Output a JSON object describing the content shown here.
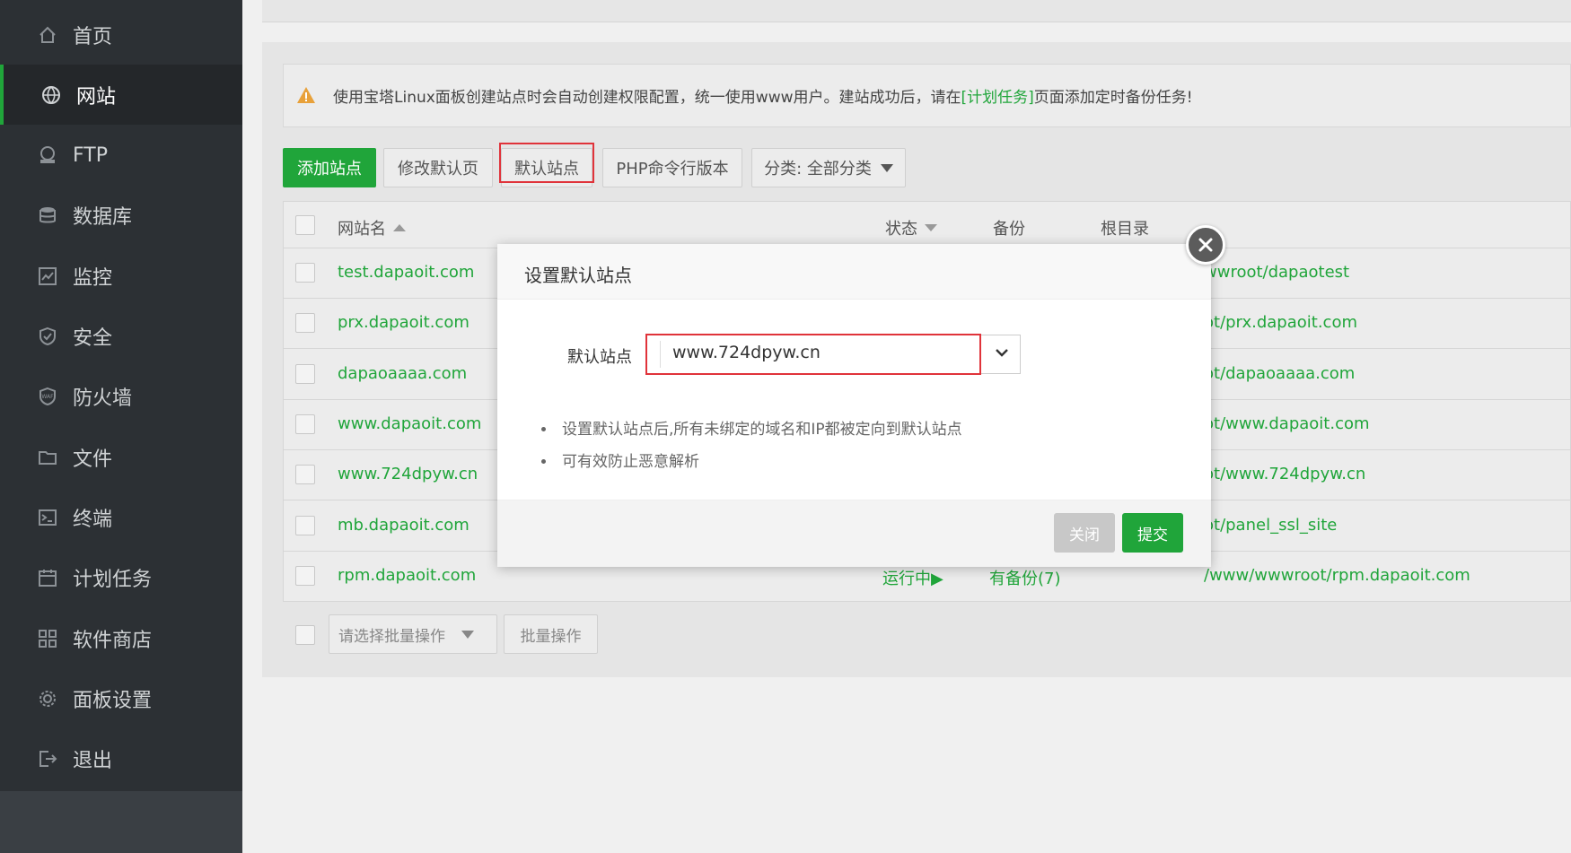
{
  "colors": {
    "accent": "#20a53a",
    "highlight": "#e0333a",
    "sidebar_bg": "#2c3034"
  },
  "sidebar": {
    "items": [
      {
        "label": "首页",
        "icon": "home-icon",
        "active": false
      },
      {
        "label": "网站",
        "icon": "globe-icon",
        "active": true
      },
      {
        "label": "FTP",
        "icon": "ftp-icon",
        "active": false
      },
      {
        "label": "数据库",
        "icon": "database-icon",
        "active": false
      },
      {
        "label": "监控",
        "icon": "monitor-icon",
        "active": false
      },
      {
        "label": "安全",
        "icon": "shield-icon",
        "active": false
      },
      {
        "label": "防火墙",
        "icon": "waf-shield-icon",
        "active": false
      },
      {
        "label": "文件",
        "icon": "folder-icon",
        "active": false
      },
      {
        "label": "终端",
        "icon": "terminal-icon",
        "active": false
      },
      {
        "label": "计划任务",
        "icon": "calendar-icon",
        "active": false
      },
      {
        "label": "软件商店",
        "icon": "grid-icon",
        "active": false
      },
      {
        "label": "面板设置",
        "icon": "gear-icon",
        "active": false
      },
      {
        "label": "退出",
        "icon": "logout-icon",
        "active": false
      }
    ]
  },
  "notice": {
    "prefix": "使用宝塔Linux面板创建站点时会自动创建权限配置，统一使用www用户。建站成功后，请在",
    "link": "[计划任务]",
    "suffix": "页面添加定时备份任务!"
  },
  "toolbar": {
    "add_site": "添加站点",
    "edit_default_page": "修改默认页",
    "default_site": "默认站点",
    "php_cli_version": "PHP命令行版本",
    "category": "分类: 全部分类"
  },
  "table": {
    "headers": {
      "name": "网站名",
      "status": "状态",
      "backup": "备份",
      "root": "根目录"
    },
    "rows": [
      {
        "name": "test.dapaoit.com",
        "root": "wwroot/dapaotest",
        "status": "",
        "backup": ""
      },
      {
        "name": "prx.dapaoit.com",
        "root": "ot/prx.dapaoit.com",
        "status": "",
        "backup": ""
      },
      {
        "name": "dapaoaaaa.com",
        "root": "ot/dapaoaaaa.com",
        "status": "",
        "backup": ""
      },
      {
        "name": "www.dapaoit.com",
        "root": "ot/www.dapaoit.com",
        "status": "",
        "backup": ""
      },
      {
        "name": "www.724dpyw.cn",
        "root": "ot/www.724dpyw.cn",
        "status": "",
        "backup": ""
      },
      {
        "name": "mb.dapaoit.com",
        "root": "ot/panel_ssl_site",
        "status": "",
        "backup": ""
      },
      {
        "name": "rpm.dapaoit.com",
        "root": "/www/wwwroot/rpm.dapaoit.com",
        "status": "运行中▶",
        "backup": "有备份(7)"
      }
    ]
  },
  "bulk": {
    "select_placeholder": "请选择批量操作",
    "action": "批量操作"
  },
  "modal": {
    "title": "设置默认站点",
    "field_label": "默认站点",
    "selected_value": "www.724dpyw.cn",
    "tips": [
      "设置默认站点后,所有未绑定的域名和IP都被定向到默认站点",
      "可有效防止恶意解析"
    ],
    "close_button": "关闭",
    "submit_button": "提交"
  }
}
